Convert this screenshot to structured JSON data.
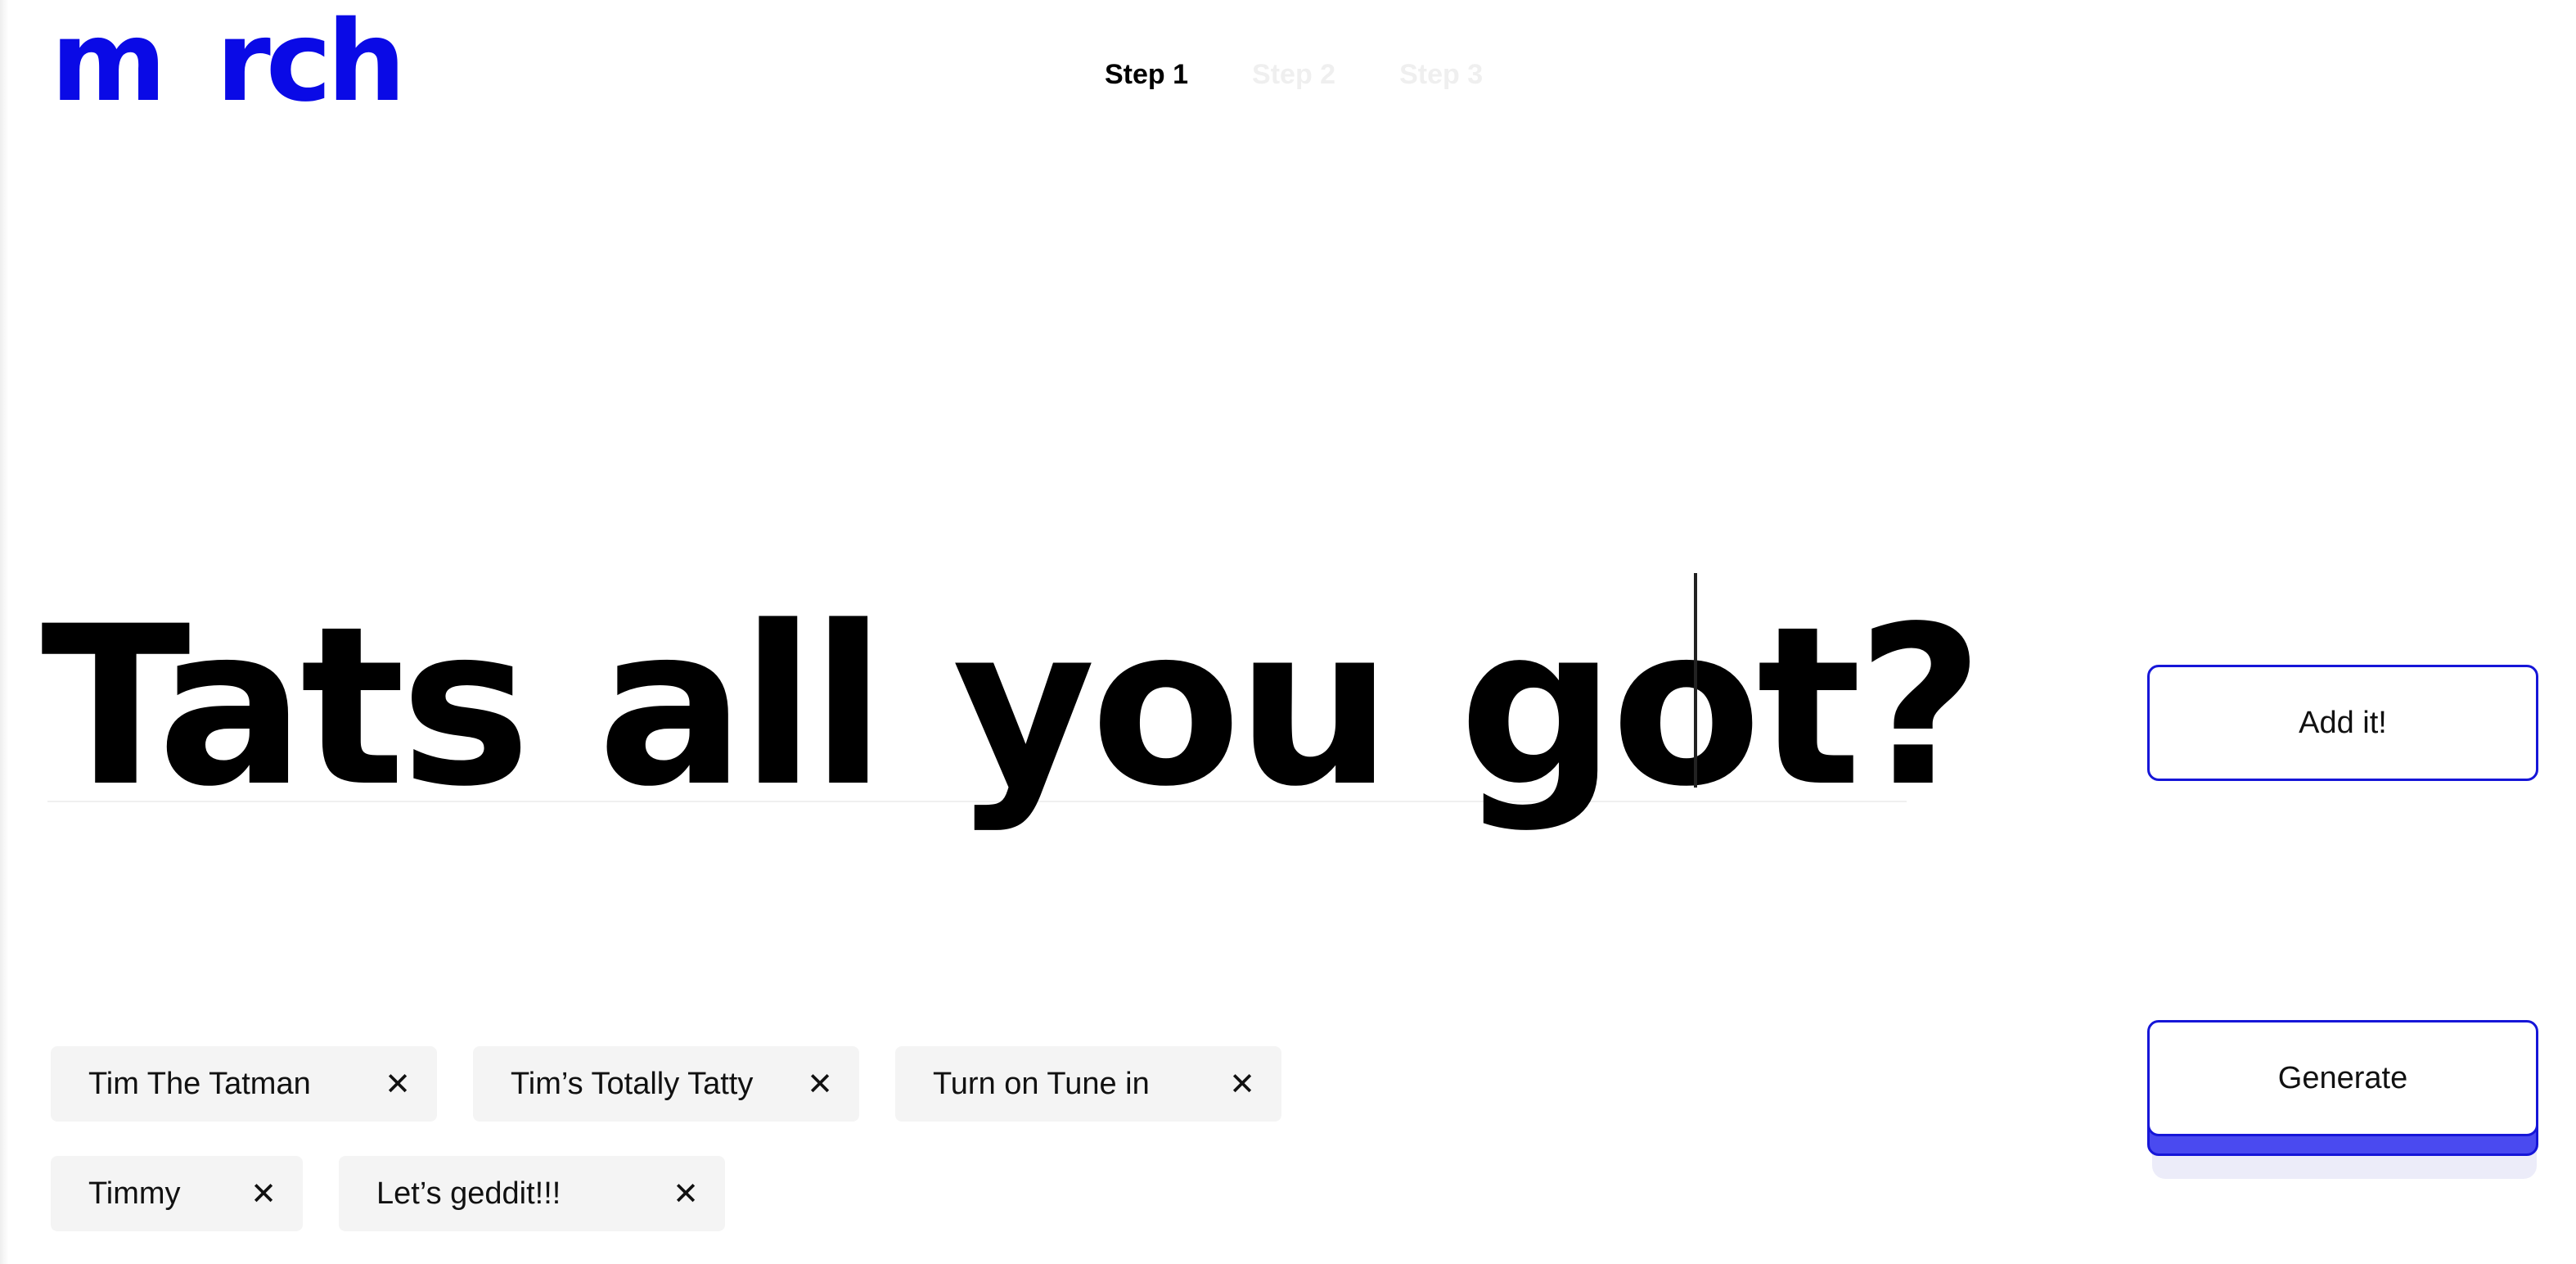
{
  "brand": {
    "logo_left": "m",
    "logo_right": "rch",
    "color": "#0a0ae6"
  },
  "steps": [
    {
      "label": "Step 1",
      "active": true
    },
    {
      "label": "Step 2",
      "active": false
    },
    {
      "label": "Step 3",
      "active": false
    }
  ],
  "input": {
    "value": "Tats all you got?"
  },
  "buttons": {
    "add_label": "Add it!",
    "generate_label": "Generate",
    "accent": "#1616d8"
  },
  "chips": [
    {
      "label": "Tim The Tatman",
      "remove_icon": "close-icon"
    },
    {
      "label": "Tim’s Totally Tatty",
      "remove_icon": "close-icon"
    },
    {
      "label": "Turn on Tune in",
      "remove_icon": "close-icon"
    },
    {
      "label": "Timmy",
      "remove_icon": "close-icon"
    },
    {
      "label": "Let’s geddit!!!",
      "remove_icon": "close-icon"
    }
  ],
  "chip_remove_glyph": "✕"
}
